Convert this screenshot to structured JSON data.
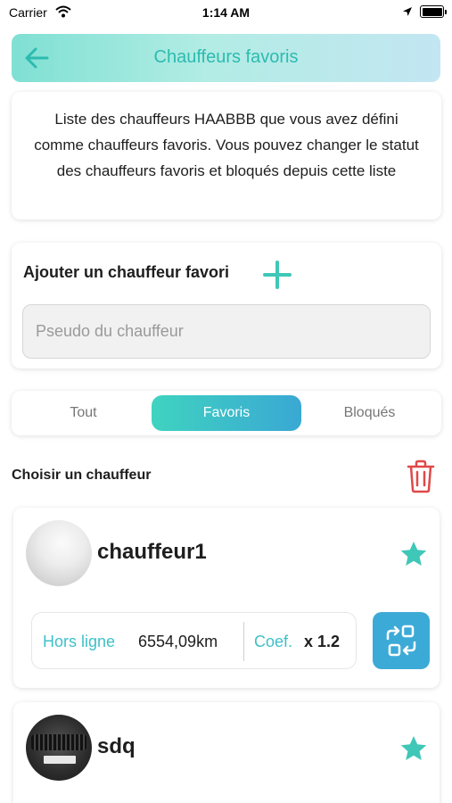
{
  "status_bar": {
    "carrier": "Carrier",
    "time": "1:14 AM"
  },
  "header": {
    "title": "Chauffeurs favoris",
    "back_icon": "arrow-left-icon"
  },
  "info": {
    "text": "Liste des chauffeurs HAABBB que vous avez défini comme chauffeurs favoris. Vous pouvez changer le statut des chauffeurs favoris et bloqués depuis cette liste"
  },
  "add_favorite": {
    "title": "Ajouter un chauffeur favori",
    "icon": "plus-icon",
    "placeholder": "Pseudo du chauffeur",
    "value": ""
  },
  "tabs": [
    {
      "label": "Tout",
      "active": false
    },
    {
      "label": "Favoris",
      "active": true
    },
    {
      "label": "Bloqués",
      "active": false
    }
  ],
  "list": {
    "title": "Choisir un chauffeur",
    "delete_icon": "trash-icon"
  },
  "drivers": [
    {
      "name": "chauffeur1",
      "favorite": true,
      "status": "Hors ligne",
      "distance": "6554,09km",
      "coef_label": "Coef.",
      "coef": "x 1.2"
    },
    {
      "name": "sdq",
      "favorite": true
    }
  ],
  "colors": {
    "accent": "#2dbbb0",
    "button_blue": "#3caad7",
    "delete_red": "#e04848",
    "star": "#3fc7b8"
  }
}
